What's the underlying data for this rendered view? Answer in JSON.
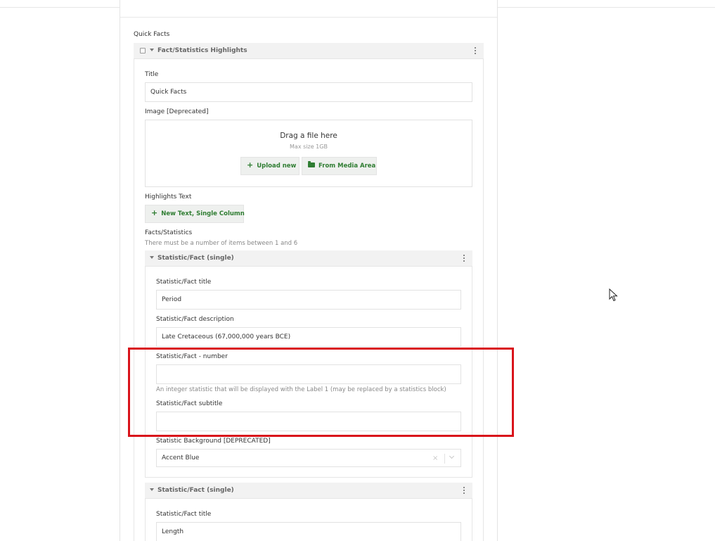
{
  "form": {
    "section_label": "Quick Facts",
    "component_title": "Fact/Statistics Highlights",
    "title_label": "Title",
    "title_value": "Quick Facts",
    "image_label": "Image [Deprecated]",
    "dropzone": {
      "title": "Drag a file here",
      "max_size": "Max size 1GB",
      "upload_label": "Upload new",
      "media_label": "From Media Area"
    },
    "highlights_label": "Highlights Text",
    "new_text_label": "New Text, Single Column",
    "facts_label": "Facts/Statistics",
    "facts_hint": "There must be a number of items between 1 and 6",
    "stat1": {
      "header": "Statistic/Fact (single)",
      "title_label": "Statistic/Fact title",
      "title_value": "Period",
      "desc_label": "Statistic/Fact description",
      "desc_value": "Late Cretaceous (67,000,000 years BCE)",
      "number_label": "Statistic/Fact - number",
      "number_value": "",
      "number_hint": "An integer statistic that will be displayed with the Label 1 (may be replaced by a statistics block)",
      "subtitle_label": "Statistic/Fact subtitle",
      "subtitle_value": "",
      "bg_label": "Statistic Background [DEPRECATED]",
      "bg_value": "Accent Blue"
    },
    "stat2": {
      "header": "Statistic/Fact (single)",
      "title_label": "Statistic/Fact title",
      "title_value": "Length"
    }
  },
  "icons": {
    "plus": "+",
    "clear": "×"
  },
  "colors": {
    "accent": "#2e9e3e",
    "button_text": "#2f7d32",
    "highlight": "#d9141b"
  }
}
